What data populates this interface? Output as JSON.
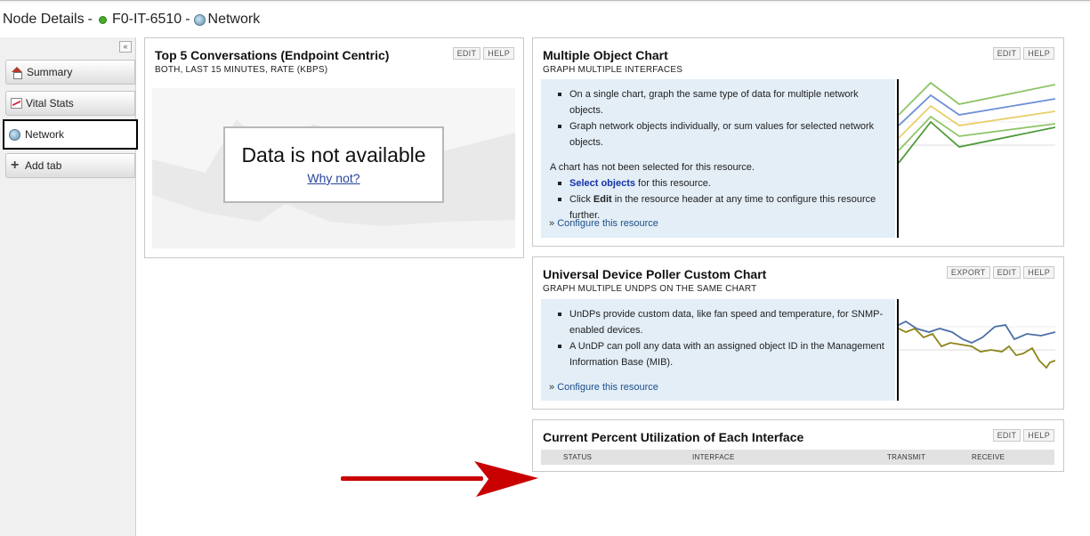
{
  "header": {
    "title": "Node Details",
    "node": "F0-IT-6510",
    "view": "Network",
    "separator": "-"
  },
  "sidebar": {
    "collapse_label": "«",
    "tabs": [
      {
        "label": "Summary",
        "icon": "home-icon"
      },
      {
        "label": "Vital Stats",
        "icon": "chart-icon"
      },
      {
        "label": "Network",
        "icon": "globe-icon",
        "active": true
      },
      {
        "label": "Add tab",
        "icon": "plus-icon"
      }
    ]
  },
  "panels": {
    "conversations": {
      "title": "Top 5 Conversations (Endpoint Centric)",
      "subtitle": "BOTH, LAST 15 MINUTES, RATE (KBPS)",
      "buttons": [
        "EDIT",
        "HELP"
      ],
      "unavailable_text": "Data is not available",
      "why_link": "Why not?"
    },
    "multi_object": {
      "title": "Multiple Object Chart",
      "subtitle": "GRAPH MULTIPLE INTERFACES",
      "buttons": [
        "EDIT",
        "HELP"
      ],
      "bullets": [
        "On a single chart, graph the same type of data for multiple network objects.",
        "Graph network objects individually, or sum values for selected network objects."
      ],
      "not_selected": "A chart has not been selected for this resource.",
      "select_link": "Select objects",
      "select_suffix": " for this resource.",
      "click_prefix": "Click ",
      "click_bold": "Edit",
      "click_suffix": " in the resource header at any time to configure this resource further.",
      "configure": "Configure this resource"
    },
    "undp": {
      "title": "Universal Device Poller Custom Chart",
      "subtitle": "GRAPH MULTIPLE UNDPS ON THE SAME CHART",
      "buttons": [
        "EXPORT",
        "EDIT",
        "HELP"
      ],
      "bullets": [
        "UnDPs provide custom data, like fan speed and temperature, for SNMP-enabled devices.",
        "A UnDP can poll any data with an assigned object ID in the Management Information Base (MIB)."
      ],
      "configure": "Configure this resource"
    },
    "utilization": {
      "title": "Current Percent Utilization of Each Interface",
      "buttons": [
        "EDIT",
        "HELP"
      ],
      "columns": [
        "STATUS",
        "INTERFACE",
        "TRANSMIT",
        "RECEIVE"
      ]
    }
  },
  "colors": {
    "info_bg": "#e3eef7",
    "arrow": "#c80000",
    "status_up": "#4caa2a"
  }
}
